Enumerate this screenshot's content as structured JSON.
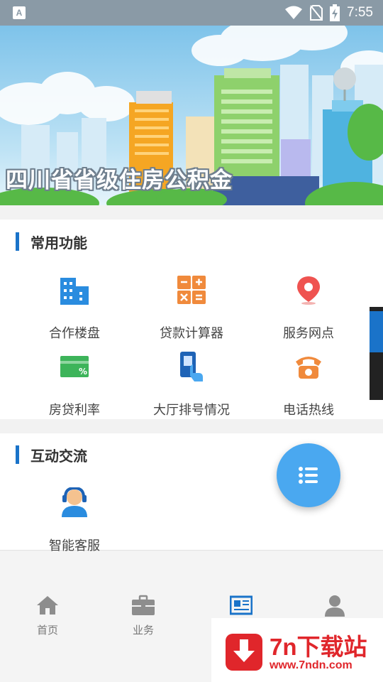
{
  "status_bar": {
    "time": "7:55",
    "app_badge": "A"
  },
  "banner": {
    "title": "四川省省级住房公积金"
  },
  "common_functions": {
    "title": "常用功能",
    "items": [
      {
        "label": "合作楼盘",
        "icon": "building-icon"
      },
      {
        "label": "贷款计算器",
        "icon": "calculator-icon"
      },
      {
        "label": "服务网点",
        "icon": "location-pin-icon"
      },
      {
        "label": "房贷利率",
        "icon": "rate-card-icon"
      },
      {
        "label": "大厅排号情况",
        "icon": "queue-ticket-icon"
      },
      {
        "label": "电话热线",
        "icon": "telephone-icon"
      }
    ]
  },
  "interaction": {
    "title": "互动交流",
    "items": [
      {
        "label": "智能客服",
        "icon": "customer-service-icon"
      }
    ]
  },
  "bottom_nav": {
    "tabs": [
      {
        "label": "首页",
        "icon": "home-icon"
      },
      {
        "label": "业务",
        "icon": "briefcase-icon"
      },
      {
        "label": "",
        "icon": "news-icon"
      },
      {
        "label": "",
        "icon": "person-icon"
      }
    ]
  },
  "watermark": {
    "brand": "7n下载站",
    "url": "www.7ndn.com"
  },
  "colors": {
    "accent": "#1a73c9",
    "fab": "#4aa8f0",
    "watermark": "#e0262b"
  }
}
